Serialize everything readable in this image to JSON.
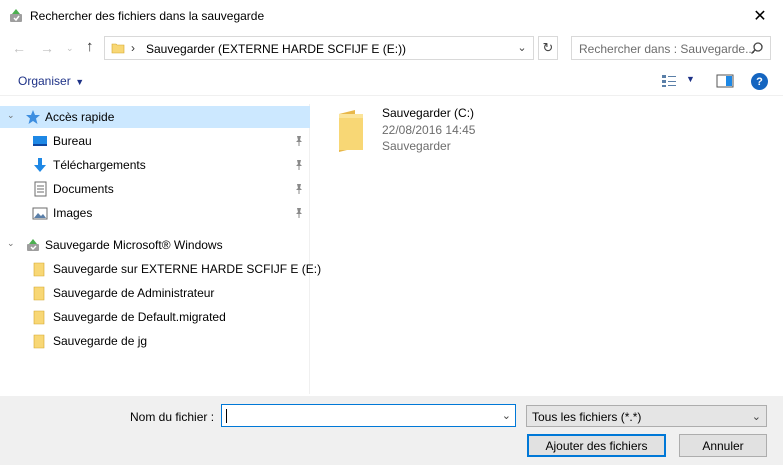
{
  "window": {
    "title": "Rechercher des fichiers dans la sauvegarde",
    "close_glyph": "✕"
  },
  "navigation": {
    "address_separator": "›",
    "address_path": "Sauvegarder (EXTERNE HARDE SCFIJF E (E:))",
    "search_placeholder": "Rechercher dans : Sauvegarde..."
  },
  "toolbar": {
    "organise_label": "Organiser"
  },
  "sidebar": {
    "quick_access": "Accès rapide",
    "quick_items": [
      {
        "label": "Bureau",
        "icon": "desktop-icon"
      },
      {
        "label": "Téléchargements",
        "icon": "download-icon"
      },
      {
        "label": "Documents",
        "icon": "documents-icon"
      },
      {
        "label": "Images",
        "icon": "pictures-icon"
      }
    ],
    "backup_root": "Sauvegarde Microsoft® Windows",
    "backup_items": [
      {
        "label": "Sauvegarde sur EXTERNE HARDE SCFIJF E (E:)"
      },
      {
        "label": "Sauvegarde de Administrateur"
      },
      {
        "label": "Sauvegarde de Default.migrated"
      },
      {
        "label": "Sauvegarde de jg"
      }
    ]
  },
  "content": {
    "items": [
      {
        "name": "Sauvegarder (C:)",
        "date": "22/08/2016 14:45",
        "type": "Sauvegarder"
      }
    ]
  },
  "footer": {
    "filename_label": "Nom du fichier :",
    "filename_value": "",
    "filter_value": "Tous les fichiers (*.*)",
    "add_button": "Ajouter des fichiers",
    "cancel_button": "Annuler"
  },
  "colors": {
    "accent": "#0078d7",
    "selection": "#cce8ff",
    "link": "#1e3287",
    "folder": "#f8d775"
  }
}
